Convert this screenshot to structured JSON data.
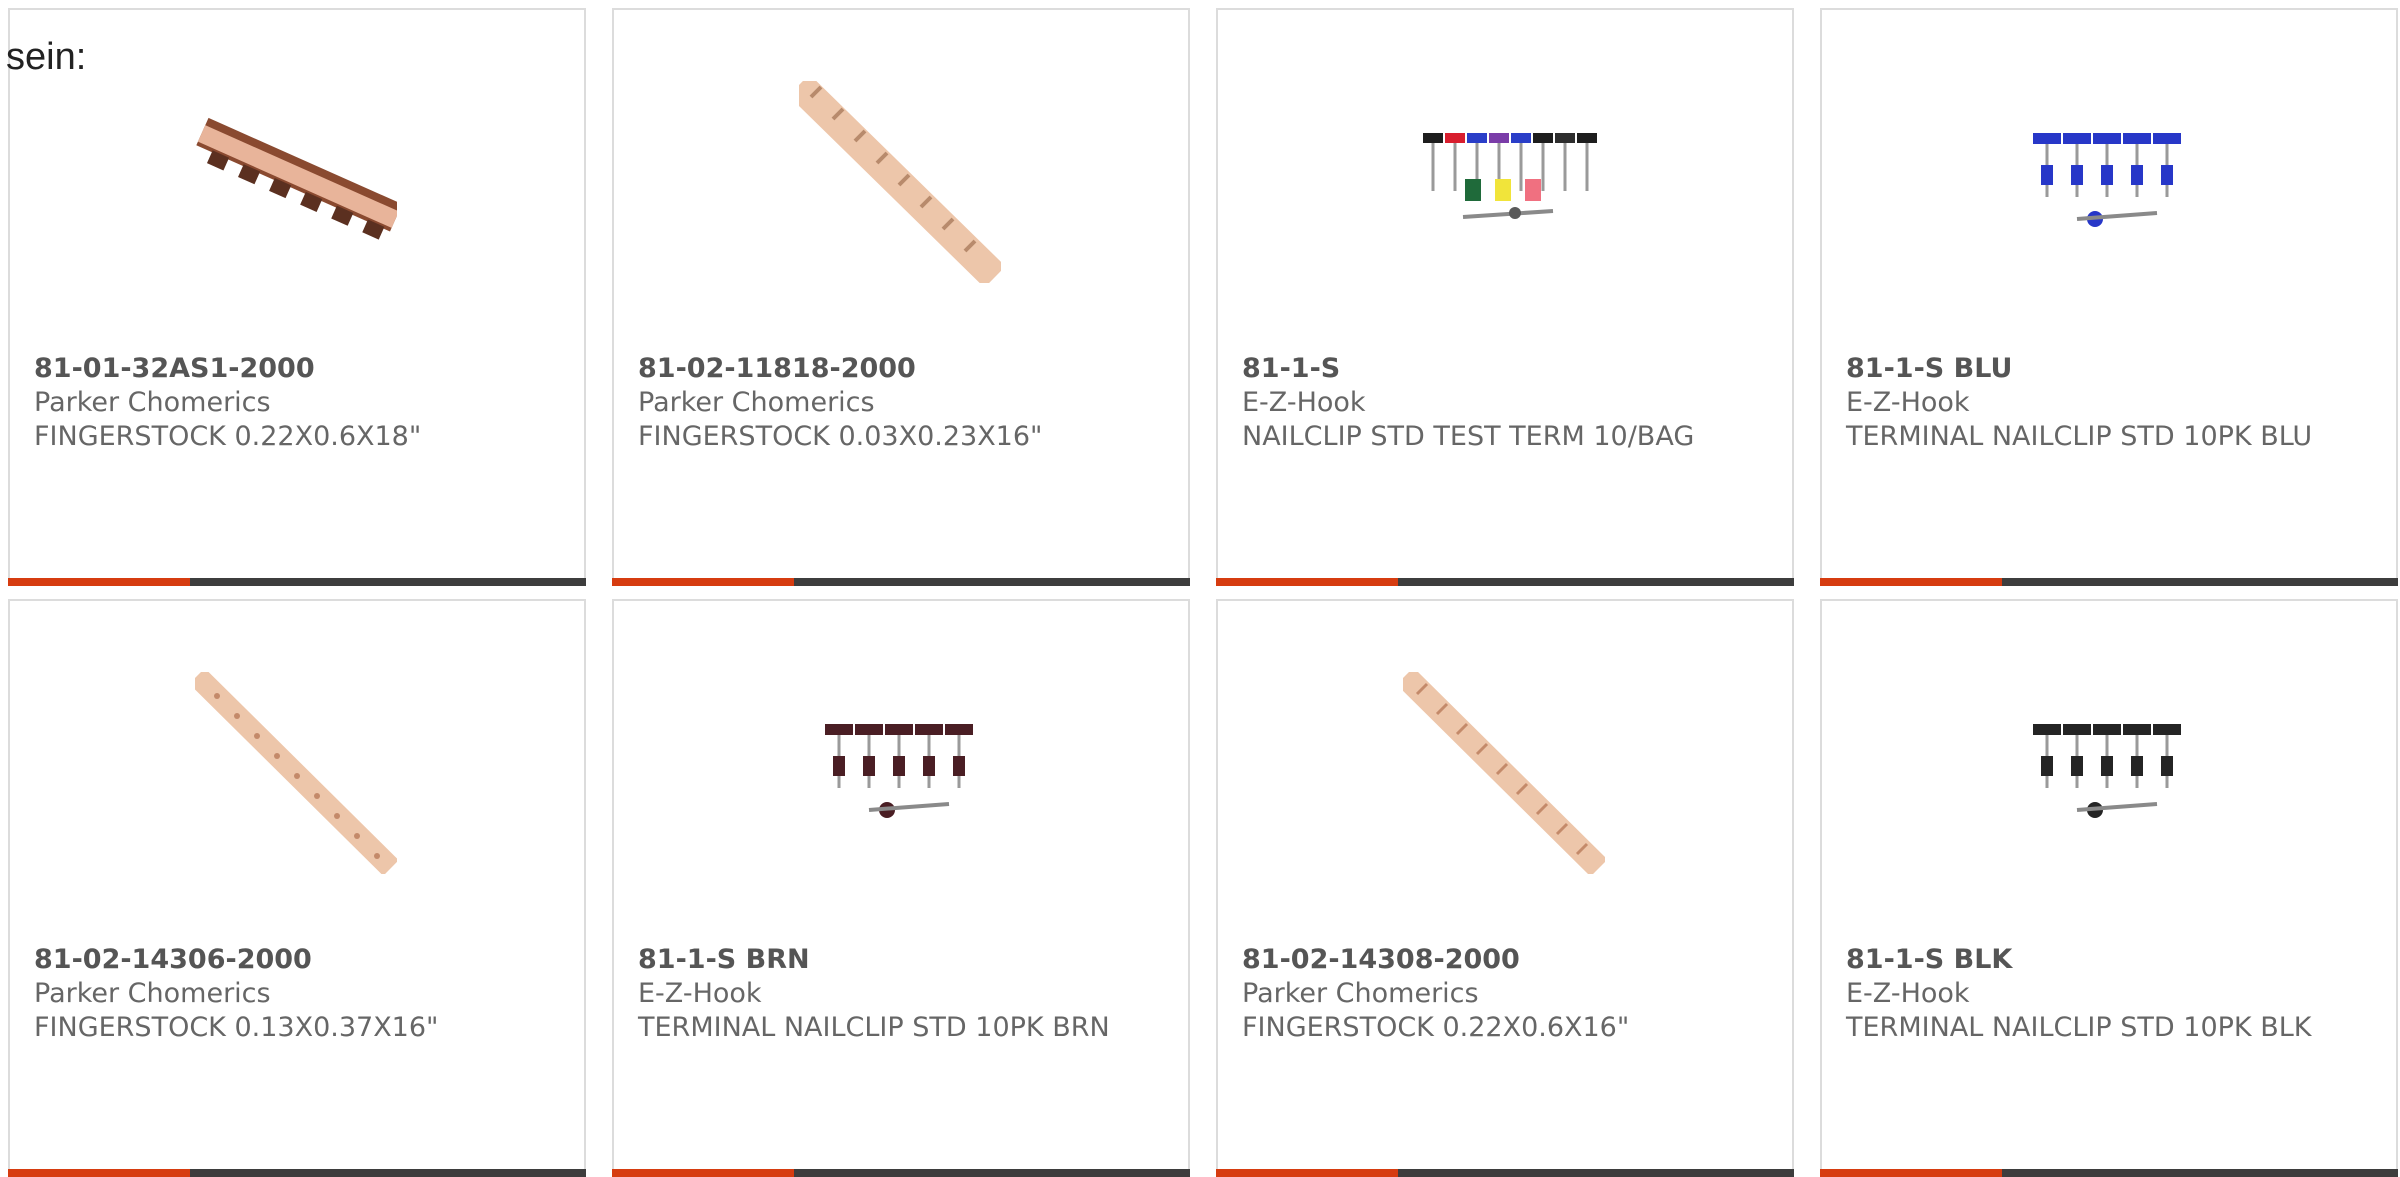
{
  "intro_text": "sein:",
  "colors": {
    "accent": "#d63c10",
    "bar": "#3d3d3d",
    "border": "#dcdcdc",
    "text": "#666666"
  },
  "products": [
    {
      "sku": "81-01-32AS1-2000",
      "brand": "Parker Chomerics",
      "desc": "FINGERSTOCK 0.22X0.6X18\"",
      "image": "fingerstock-clip-image"
    },
    {
      "sku": "81-02-11818-2000",
      "brand": "Parker Chomerics",
      "desc": "FINGERSTOCK 0.03X0.23X16\"",
      "image": "fingerstock-strip-image"
    },
    {
      "sku": "81-1-S",
      "brand": "E-Z-Hook",
      "desc": "NAILCLIP STD TEST TERM 10/BAG",
      "image": "multicolor-nailclips-image"
    },
    {
      "sku": "81-1-S BLU",
      "brand": "E-Z-Hook",
      "desc": "TERMINAL NAILCLIP STD 10PK BLU",
      "image": "blue-nailclips-image"
    },
    {
      "sku": "81-02-14306-2000",
      "brand": "Parker Chomerics",
      "desc": "FINGERSTOCK 0.13X0.37X16\"",
      "image": "fingerstock-strip-image"
    },
    {
      "sku": "81-1-S BRN",
      "brand": "E-Z-Hook",
      "desc": "TERMINAL NAILCLIP STD 10PK BRN",
      "image": "brown-nailclips-image"
    },
    {
      "sku": "81-02-14308-2000",
      "brand": "Parker Chomerics",
      "desc": "FINGERSTOCK 0.22X0.6X16\"",
      "image": "fingerstock-strip-image"
    },
    {
      "sku": "81-1-S BLK",
      "brand": "E-Z-Hook",
      "desc": "TERMINAL NAILCLIP STD 10PK BLK",
      "image": "black-nailclips-image"
    }
  ]
}
